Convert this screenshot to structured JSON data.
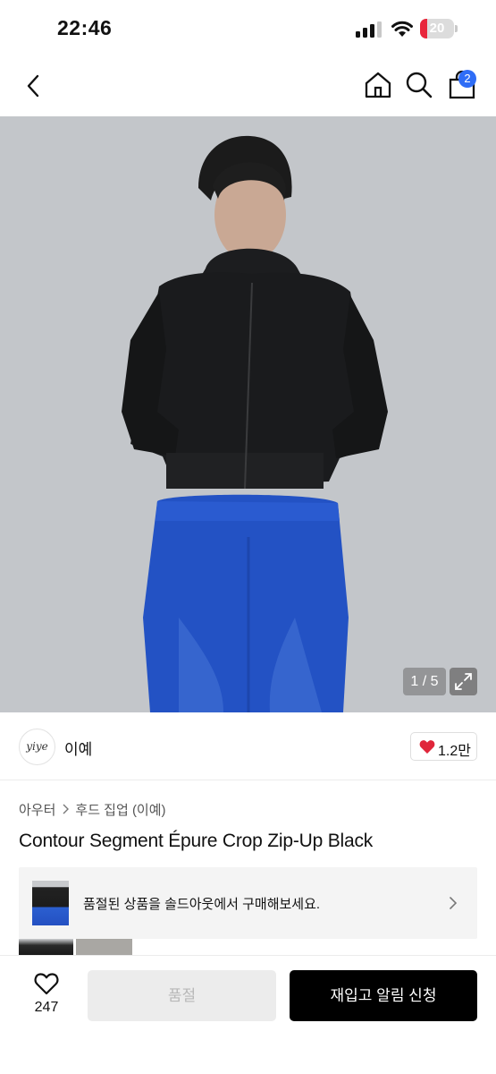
{
  "status_bar": {
    "time": "22:46",
    "battery_level": "20",
    "battery_fraction": 0.2,
    "battery_color": "#e8263b"
  },
  "nav": {
    "cart_badge": "2",
    "icons": [
      "chevron-left-icon",
      "home-icon",
      "search-icon",
      "shopping-bag-icon"
    ],
    "badge_color": "#2f6df6"
  },
  "gallery": {
    "counter": "1 / 5"
  },
  "brand": {
    "logo_text": "yiye",
    "name": "이예",
    "likes": "1.2만",
    "heart_color": "#e0263a"
  },
  "product": {
    "breadcrumb": [
      "아우터",
      "후드 집업 (이예)"
    ],
    "title": "Contour Segment Épure Crop Zip-Up Black"
  },
  "soldout_banner": {
    "message": "품절된 상품을 솔드아웃에서 구매해보세요."
  },
  "bottom_bar": {
    "wish_count": "247",
    "soldout_label": "품절",
    "restock_label": "재입고 알림 신청"
  }
}
